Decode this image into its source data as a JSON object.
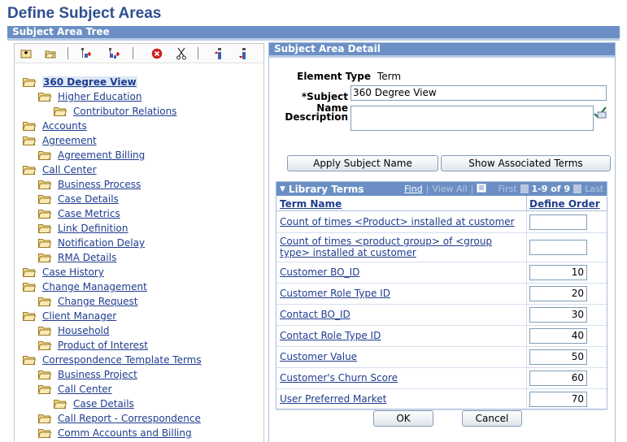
{
  "page": {
    "title": "Define Subject Areas"
  },
  "tree_section": {
    "title": "Subject Area Tree"
  },
  "toolbar": {
    "icons": [
      "insert-sibling-icon",
      "insert-child-icon",
      "add-element-icon",
      "add-child-element-icon",
      "delete-icon",
      "cut-icon",
      "move-up-icon",
      "move-down-icon"
    ]
  },
  "tree": {
    "nodes": [
      {
        "label": "360 Degree View",
        "level": 0,
        "selected": true
      },
      {
        "label": "Higher Education",
        "level": 1
      },
      {
        "label": "Contributor Relations",
        "level": 2
      },
      {
        "label": "Accounts",
        "level": 0
      },
      {
        "label": "Agreement",
        "level": 0
      },
      {
        "label": "Agreement Billing",
        "level": 1
      },
      {
        "label": "Call Center",
        "level": 0
      },
      {
        "label": "Business Process",
        "level": 1
      },
      {
        "label": "Case Details",
        "level": 1
      },
      {
        "label": "Case Metrics",
        "level": 1
      },
      {
        "label": "Link Definition",
        "level": 1
      },
      {
        "label": "Notification Delay",
        "level": 1
      },
      {
        "label": "RMA Details",
        "level": 1
      },
      {
        "label": "Case History",
        "level": 0
      },
      {
        "label": "Change Management",
        "level": 0
      },
      {
        "label": "Change Request",
        "level": 1
      },
      {
        "label": "Client Manager",
        "level": 0
      },
      {
        "label": "Household",
        "level": 1
      },
      {
        "label": "Product of Interest",
        "level": 1
      },
      {
        "label": "Correspondence Template Terms",
        "level": 0
      },
      {
        "label": "Business Project",
        "level": 1
      },
      {
        "label": "Call Center",
        "level": 1
      },
      {
        "label": "Case Details",
        "level": 2
      },
      {
        "label": "Call Report - Correspondence",
        "level": 1
      },
      {
        "label": "Comm Accounts and Billing",
        "level": 1
      }
    ]
  },
  "detail": {
    "title": "Subject Area Detail",
    "element_type_label": "Element Type",
    "element_type_value": "Term",
    "subject_name_label": "*Subject Name",
    "subject_name_value": "360 Degree View",
    "description_label": "Description",
    "description_value": "",
    "apply_button": "Apply Subject Name",
    "show_terms_button": "Show Associated Terms"
  },
  "library_terms": {
    "title": "Library Terms",
    "find": "Find",
    "view_all": "View All",
    "first": "First",
    "count": "1-9 of 9",
    "last": "Last",
    "col_term": "Term Name",
    "col_order": "Define Order",
    "rows": [
      {
        "term": "Count of times <Product> installed at customer",
        "order": ""
      },
      {
        "term": "Count of times <product group> of <group type> installed at customer",
        "order": ""
      },
      {
        "term": "Customer BO_ID",
        "order": "10"
      },
      {
        "term": "Customer Role Type ID",
        "order": "20"
      },
      {
        "term": "Contact BO_ID",
        "order": "30"
      },
      {
        "term": "Contact Role Type ID",
        "order": "40"
      },
      {
        "term": "Customer Value",
        "order": "50"
      },
      {
        "term": "Customer's Churn Score",
        "order": "60"
      },
      {
        "term": "User Preferred Market",
        "order": "70"
      }
    ]
  },
  "actions": {
    "ok": "OK",
    "cancel": "Cancel"
  },
  "colors": {
    "header_bar": "#6b8fc4",
    "link": "#1f3d8f",
    "title": "#2f4f8f"
  }
}
